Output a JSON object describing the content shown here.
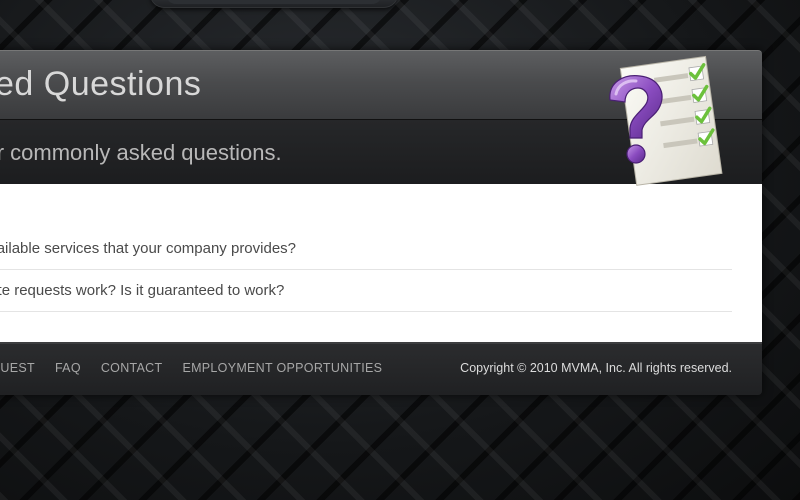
{
  "header": {
    "title": "sked Questions",
    "subtitle": "f our commonly asked questions."
  },
  "faq": {
    "items": [
      {
        "question": "on available services that your company provides?"
      },
      {
        "question": "e quote requests work? Is it guaranteed to work?"
      }
    ]
  },
  "footer": {
    "nav": [
      {
        "label": "E REQUEST"
      },
      {
        "label": "FAQ"
      },
      {
        "label": "CONTACT"
      },
      {
        "label": "EMPLOYMENT OPPORTUNITIES"
      }
    ],
    "copyright": "Copyright © 2010 MVMA, Inc. All rights reserved."
  },
  "icons": {
    "faq_icon": "question-checklist-icon"
  },
  "colors": {
    "accent_purple": "#8a4cc0",
    "check_green": "#6cc13c"
  }
}
